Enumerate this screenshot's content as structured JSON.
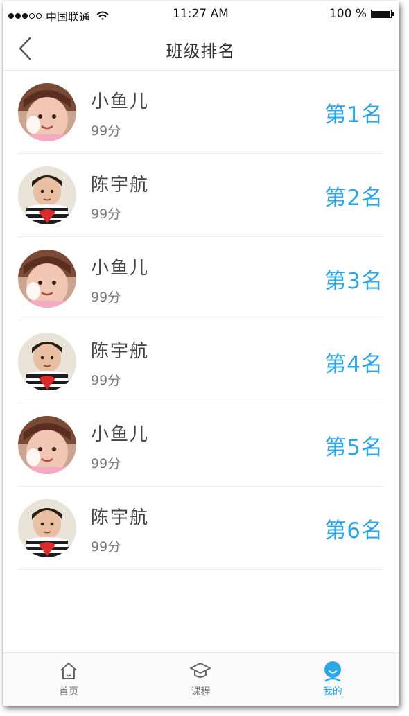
{
  "status_bar": {
    "carrier": "中国联通",
    "time": "11:27 AM",
    "battery": "100 %"
  },
  "nav": {
    "title": "班级排名",
    "back_icon": "chevron-left-icon"
  },
  "students": [
    {
      "name": "小鱼儿",
      "score": "99分",
      "rank": "第1名",
      "avatar": "girl"
    },
    {
      "name": "陈宇航",
      "score": "99分",
      "rank": "第2名",
      "avatar": "boy"
    },
    {
      "name": "小鱼儿",
      "score": "99分",
      "rank": "第3名",
      "avatar": "girl"
    },
    {
      "name": "陈宇航",
      "score": "99分",
      "rank": "第4名",
      "avatar": "boy"
    },
    {
      "name": "小鱼儿",
      "score": "99分",
      "rank": "第5名",
      "avatar": "girl"
    },
    {
      "name": "陈宇航",
      "score": "99分",
      "rank": "第6名",
      "avatar": "boy"
    }
  ],
  "tabs": [
    {
      "label": "首页",
      "icon": "home-icon",
      "active": false
    },
    {
      "label": "课程",
      "icon": "graduation-cap-icon",
      "active": false
    },
    {
      "label": "我的",
      "icon": "profile-icon",
      "active": true
    }
  ],
  "colors": {
    "accent": "#2aa7e8",
    "text": "#444444",
    "muted": "#777777"
  }
}
